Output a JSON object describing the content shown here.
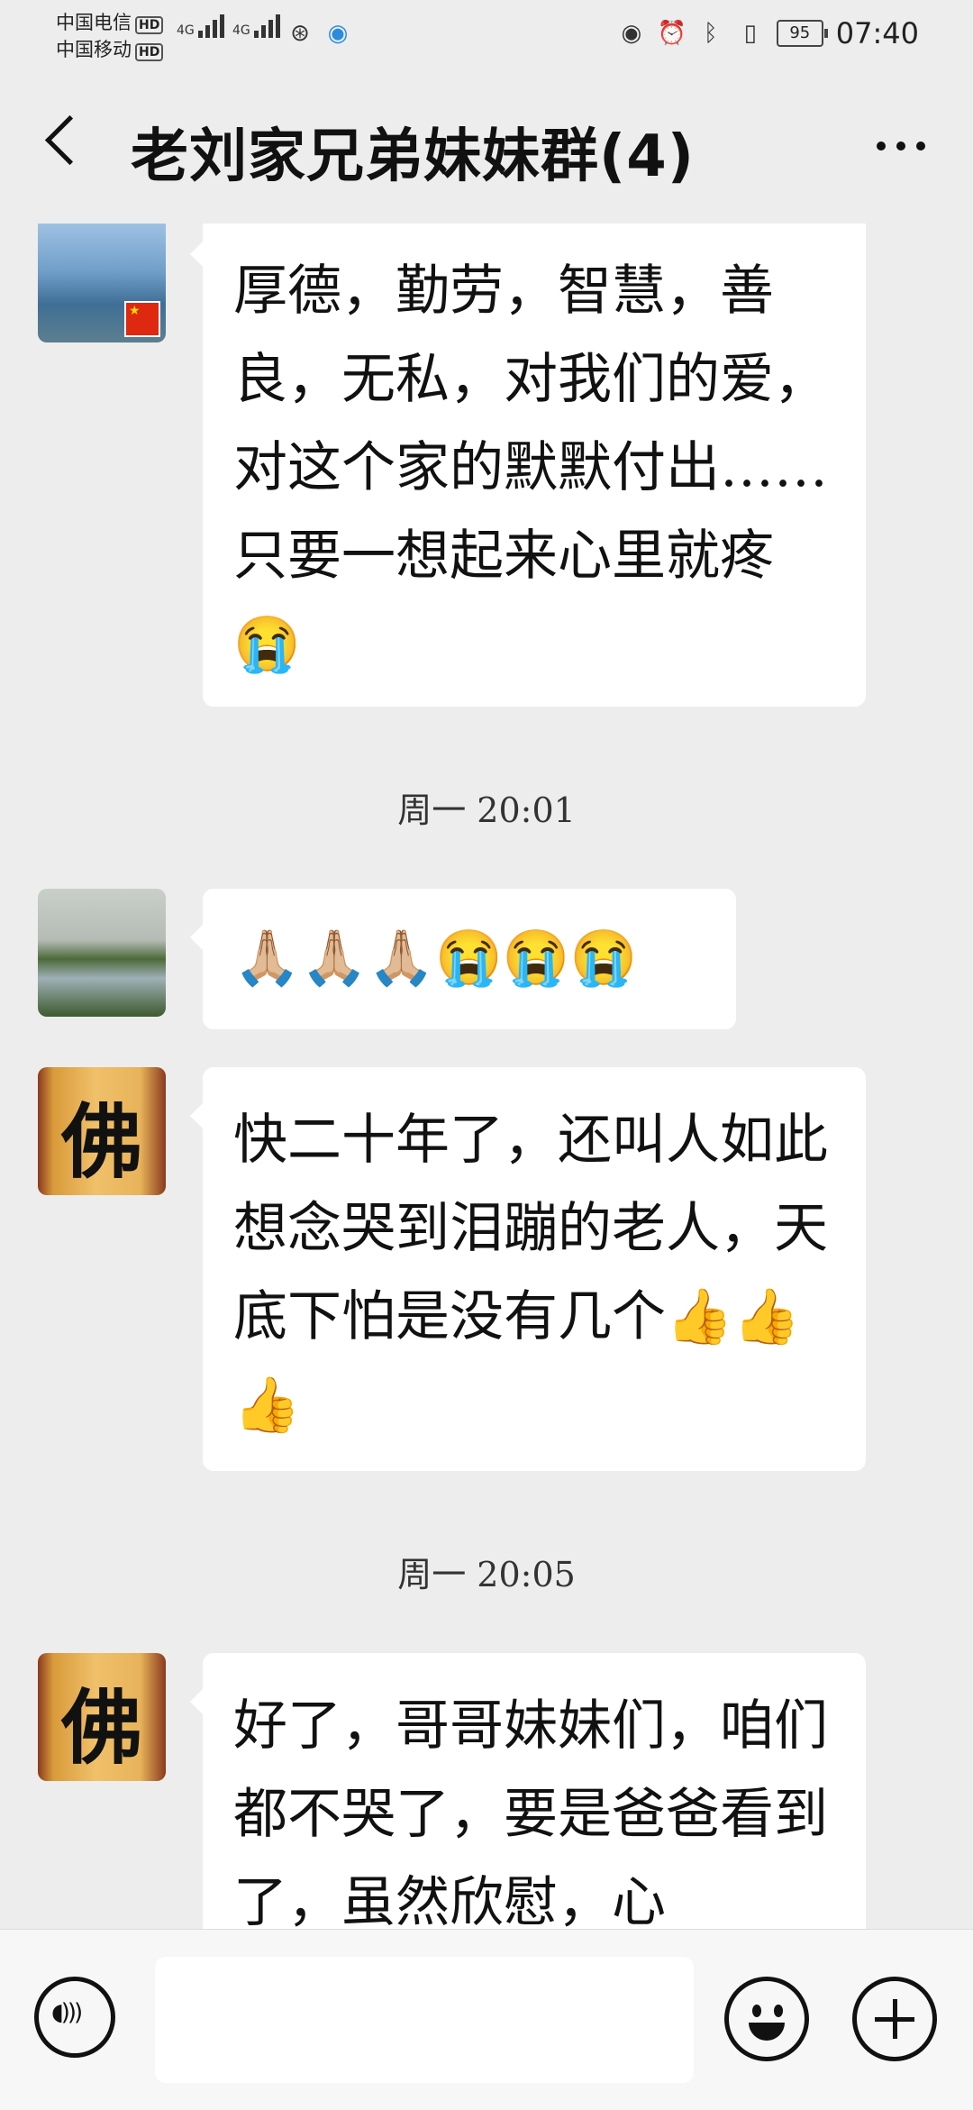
{
  "status": {
    "carrier1": "中国电信",
    "carrier2": "中国移动",
    "hd": "HD",
    "net1": "4G",
    "net2": "4G",
    "battery": "95",
    "time": "07:40"
  },
  "header": {
    "title": "老刘家兄弟妹妹群(4)"
  },
  "messages": [
    {
      "text": "厚德，勤劳，智慧，善良，无私，对我们的爱，对这个家的默默付出……只要一想起来心里就疼😭"
    },
    {
      "text": "🙏🏼🙏🏼🙏🏼😭😭😭"
    },
    {
      "text": "快二十年了，还叫人如此想念哭到泪蹦的老人，天底下怕是没有几个👍👍👍"
    },
    {
      "text": "好了，哥哥妹妹们，咱们都不哭了，要是爸爸看到了，虽然欣慰，心"
    }
  ],
  "timestamps": [
    "周一 20:01",
    "周一 20:05"
  ],
  "avatar_glyph": "佛",
  "input": {
    "placeholder": ""
  }
}
